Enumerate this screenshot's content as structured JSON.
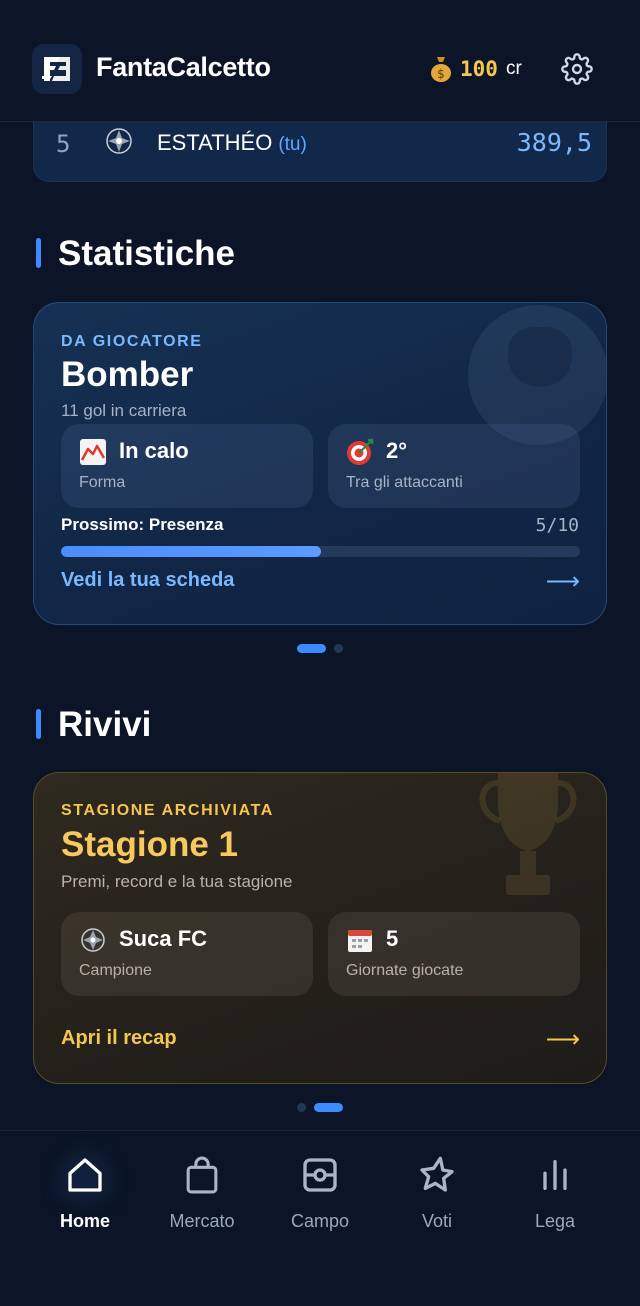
{
  "header": {
    "app_title": "FantaCalcetto",
    "credits_amount": "100",
    "credits_unit": "cr"
  },
  "ranking": {
    "position": "5",
    "team_name": "ESTATHÉO",
    "you_label": "(tu)",
    "score": "389,5"
  },
  "stats_section": {
    "title": "Statistiche",
    "card": {
      "eyebrow": "DA GIOCATORE",
      "title": "Bomber",
      "subtitle": "11 gol in carriera",
      "tiles": [
        {
          "emoji": "chart-decreasing-icon",
          "value": "In calo",
          "label": "Forma"
        },
        {
          "emoji": "target-icon",
          "value": "2°",
          "label": "Tra gli attaccanti"
        }
      ],
      "progress": {
        "label": "Prossimo: Presenza",
        "count": "5/10",
        "fraction": 0.5
      },
      "link_label": "Vedi la tua scheda",
      "accent": "#7ab8ff"
    },
    "pager": {
      "pages": 2,
      "active": 0
    }
  },
  "replay_section": {
    "title": "Rivivi",
    "card": {
      "eyebrow": "STAGIONE ARCHIVIATA",
      "title": "Stagione 1",
      "subtitle": "Premi, record e la tua stagione",
      "tiles": [
        {
          "emoji": "team-badge-icon",
          "value": "Suca FC",
          "label": "Campione"
        },
        {
          "emoji": "calendar-icon",
          "value": "5",
          "label": "Giornate giocate"
        }
      ],
      "link_label": "Apri il recap",
      "accent": "#f5c650"
    },
    "pager": {
      "pages": 2,
      "active": 1
    }
  },
  "bottom_nav": {
    "items": [
      {
        "label": "Home",
        "icon": "home-icon",
        "active": true
      },
      {
        "label": "Mercato",
        "icon": "bag-icon",
        "active": false
      },
      {
        "label": "Campo",
        "icon": "field-icon",
        "active": false
      },
      {
        "label": "Voti",
        "icon": "star-icon",
        "active": false
      },
      {
        "label": "Lega",
        "icon": "bar-chart-icon",
        "active": false
      }
    ]
  },
  "colors": {
    "background": "#0b1527",
    "primary": "#3d8bff",
    "gold": "#f5c650",
    "stats_eyebrow": "#7ab8ff"
  }
}
